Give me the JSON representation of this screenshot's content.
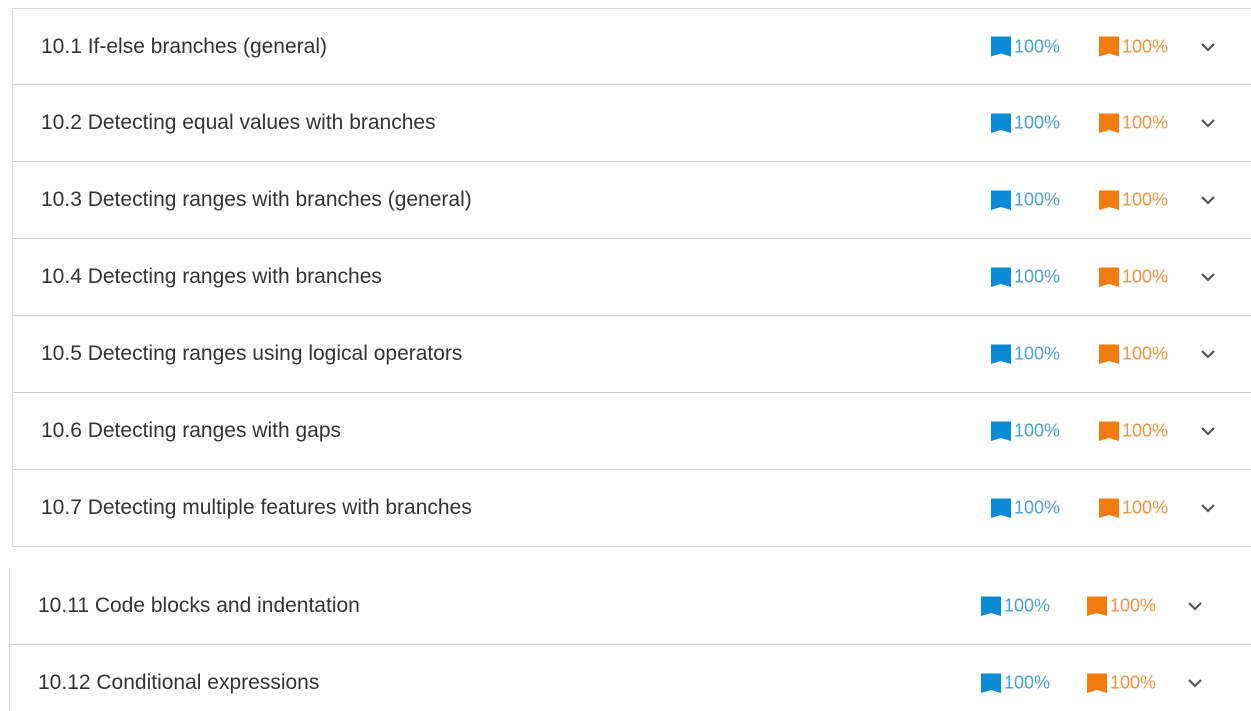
{
  "colors": {
    "participation": "#0b8ad8",
    "challenge": "#f47b0e",
    "participation_text": "#4a9fdc",
    "challenge_text": "#f5923e",
    "title_text": "#333333"
  },
  "top_sections": [
    {
      "title": "10.1 If-else branches (general)",
      "participation": "100%",
      "challenge": "100%",
      "icon": "chevron-down-icon"
    },
    {
      "title": "10.2 Detecting equal values with branches",
      "participation": "100%",
      "challenge": "100%",
      "icon": "chevron-down-icon"
    },
    {
      "title": "10.3 Detecting ranges with branches (general)",
      "participation": "100%",
      "challenge": "100%",
      "icon": "chevron-down-icon"
    },
    {
      "title": "10.4 Detecting ranges with branches",
      "participation": "100%",
      "challenge": "100%",
      "icon": "chevron-down-icon"
    },
    {
      "title": "10.5 Detecting ranges using logical operators",
      "participation": "100%",
      "challenge": "100%",
      "icon": "chevron-down-icon"
    },
    {
      "title": "10.6 Detecting ranges with gaps",
      "participation": "100%",
      "challenge": "100%",
      "icon": "chevron-down-icon"
    },
    {
      "title": "10.7 Detecting multiple features with branches",
      "participation": "100%",
      "challenge": "100%",
      "icon": "chevron-down-icon"
    }
  ],
  "bottom_sections": [
    {
      "title": "10.11 Code blocks and indentation",
      "participation": "100%",
      "challenge": "100%",
      "icon": "chevron-down-icon"
    },
    {
      "title": "10.12 Conditional expressions",
      "participation": "100%",
      "challenge": "100%",
      "icon": "chevron-down-icon"
    }
  ]
}
